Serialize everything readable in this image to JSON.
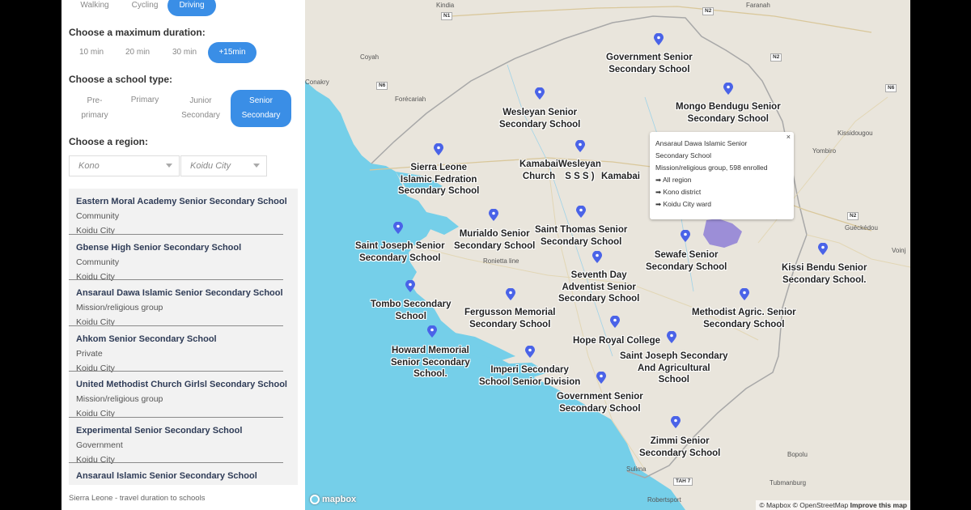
{
  "transport": {
    "walking": "Walking",
    "cycling": "Cycling",
    "driving": "Driving"
  },
  "duration": {
    "label": "Choose a maximum duration:",
    "options": [
      "10 min",
      "20 min",
      "30 min",
      "+15min"
    ]
  },
  "school_type": {
    "label": "Choose a school type:",
    "options": [
      "Pre-\nprimary",
      "Primary",
      "Junior\nSecondary",
      "Senior\nSecondary"
    ]
  },
  "region": {
    "label": "Choose a region:",
    "district": "Kono",
    "ward": "Koidu City"
  },
  "schools": [
    {
      "name": "Eastern Moral Academy Senior Secondary School",
      "type": "Community",
      "location": "Koidu City"
    },
    {
      "name": "Gbense High Senior Secondary School",
      "type": "Community",
      "location": "Koidu City"
    },
    {
      "name": "Ansaraul Dawa Islamic Senior Secondary School",
      "type": "Mission/religious group",
      "location": "Koidu City"
    },
    {
      "name": "Ahkom Senior Secondary School",
      "type": "Private",
      "location": "Koidu City"
    },
    {
      "name": "United Methodist Church Girlsl Secondary School",
      "type": "Mission/religious group",
      "location": "Koidu City"
    },
    {
      "name": "Experimental Senior Secondary School",
      "type": "Government",
      "location": "Koidu City"
    },
    {
      "name": "Ansaraul Islamic Senior Secondary School",
      "type": "",
      "location": ""
    }
  ],
  "footer": "Sierra Leone - travel duration to schools",
  "map": {
    "places": {
      "kindia": "Kindia",
      "faranah": "Faranah",
      "coyah": "Coyah",
      "conakry": "Conakry",
      "forecariah": "Forécariah",
      "kissidougou": "Kissidougou",
      "yombiro": "Yombiro",
      "gueckedou": "Guéckédou",
      "voinj": "Voinj",
      "bopolu": "Bopolu",
      "tubmanburg": "Tubmanburg",
      "sulima": "Sulima",
      "robertsport": "Robertsport",
      "ronietta": "Ronietta line"
    },
    "roads": {
      "n1": "N1",
      "n2a": "N2",
      "n2b": "N2",
      "n6a": "N6",
      "n6b": "N6",
      "n2c": "N2",
      "tah7": "TAH 7"
    },
    "school_labels": {
      "government_1": "Government Senior\nSecondary School",
      "mongo": "Mongo Bendugu Senior\nSecondary School",
      "wesleyan_sr": "Wesleyan Senior\nSecondary School",
      "sierra_leone_islamic": "Sierra Leone\nIslamic Fedration\nSecondary School",
      "kamabai_church": "Kamabai\nChurch",
      "wesleyan_sss": "Wesleyan\nS S S )",
      "kamabai": "Kamabai",
      "murialdo": "Murialdo Senior\nSecondary School",
      "saint_thomas": "Saint Thomas Senior\nSecondary School",
      "saint_joseph": "Saint Joseph Senior\nSecondary School",
      "sewafe": "Sewafe Senior\nSecondary School",
      "kissi_bendu": "Kissi Bendu Senior\nSecondary School.",
      "seventh_day": "Seventh Day\nAdventist Senior\nSecondary School",
      "tombo": "Tombo Secondary\nSchool",
      "fergusson": "Fergusson Memorial\nSecondary School",
      "methodist_agric": "Methodist Agric. Senior\nSecondary School",
      "hope_royal": "Hope Royal College",
      "howard": "Howard Memorial\nSenior Secondary\nSchool.",
      "imperi": "Imperi Secondary\nSchool Senior Division",
      "saint_joseph_agric": "Saint Joseph Secondary\nAnd Agricultural\nSchool",
      "government_2": "Government Senior\nSecondary School",
      "zimmi": "Zimmi Senior\nSecondary School"
    },
    "popup": {
      "title": "Ansaraul Dawa Islamic Senior Secondary School",
      "details": "Mission/religious group, 598 enrolled",
      "link_region": "➡ All region",
      "link_district": "➡ Kono district",
      "link_ward": "➡ Koidu City ward",
      "close": "×"
    },
    "logo": "mapbox",
    "attribution": {
      "mapbox": "© Mapbox",
      "osm": "© OpenStreetMap",
      "improve": "Improve this map"
    }
  },
  "colors": {
    "accent": "#3a8ee6",
    "ocean": "#75cfe9",
    "land": "#e9e5dc",
    "pin": "#4a63e8",
    "isochrone": "#8e7fd6"
  }
}
